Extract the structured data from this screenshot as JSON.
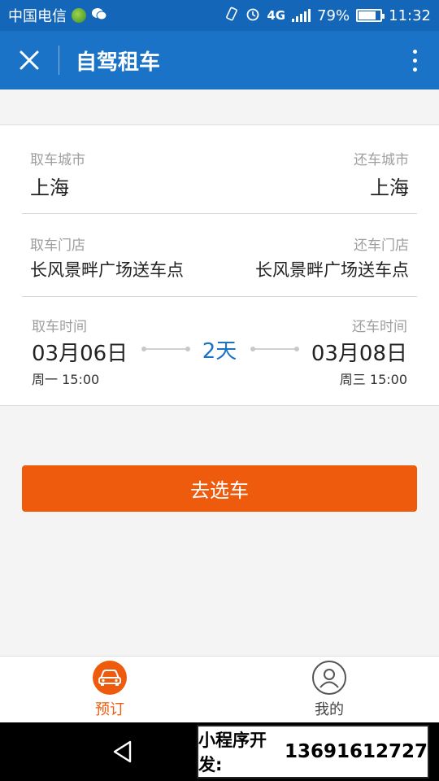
{
  "status_bar": {
    "carrier": "中国电信",
    "network": "4G",
    "battery": "79%",
    "battery_level": 0.79,
    "time": "11:32"
  },
  "header": {
    "title": "自驾租车"
  },
  "pickup_city": {
    "label": "取车城市",
    "value": "上海"
  },
  "return_city": {
    "label": "还车城市",
    "value": "上海"
  },
  "pickup_store": {
    "label": "取车门店",
    "value": "长风景畔广场送车点"
  },
  "return_store": {
    "label": "还车门店",
    "value": "长风景畔广场送车点"
  },
  "pickup_time": {
    "label": "取车时间",
    "date": "03月06日",
    "weekday_time": "周一 15:00"
  },
  "return_time": {
    "label": "还车时间",
    "date": "03月08日",
    "weekday_time": "周三 15:00"
  },
  "duration": "2天",
  "action_button": "去选车",
  "tabs": [
    {
      "label": "预订",
      "icon": "car-icon",
      "active": true
    },
    {
      "label": "我的",
      "icon": "user-icon",
      "active": false
    }
  ],
  "promo": {
    "text": "小程序开发:",
    "phone": "13691612727"
  },
  "colors": {
    "primary_blue": "#1a73c6",
    "accent_orange": "#ef5b0c"
  }
}
